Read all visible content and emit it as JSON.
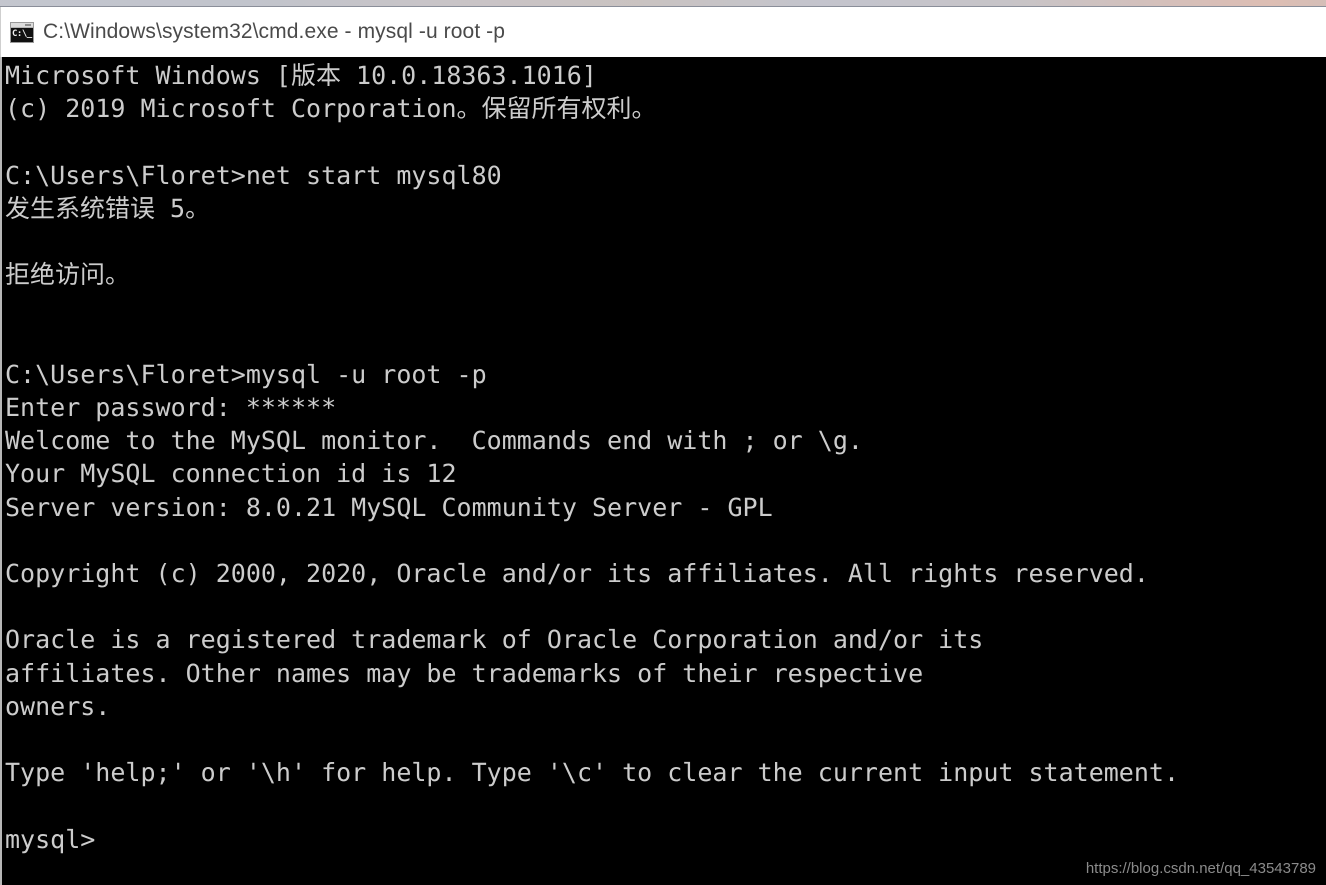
{
  "window": {
    "title": "C:\\Windows\\system32\\cmd.exe - mysql  -u root -p",
    "icon_name": "cmd-console-icon",
    "icon_glyph": "C:\\_",
    "background_color": "#000000",
    "text_color": "#cccccc",
    "titlebar_color": "#ffffff"
  },
  "terminal": {
    "lines": [
      "Microsoft Windows [版本 10.0.18363.1016]",
      "(c) 2019 Microsoft Corporation。保留所有权利。",
      "",
      "C:\\Users\\Floret>net start mysql80",
      "发生系统错误 5。",
      "",
      "拒绝访问。",
      "",
      "",
      "C:\\Users\\Floret>mysql -u root -p",
      "Enter password: ******",
      "Welcome to the MySQL monitor.  Commands end with ; or \\g.",
      "Your MySQL connection id is 12",
      "Server version: 8.0.21 MySQL Community Server - GPL",
      "",
      "Copyright (c) 2000, 2020, Oracle and/or its affiliates. All rights reserved.",
      "",
      "Oracle is a registered trademark of Oracle Corporation and/or its",
      "affiliates. Other names may be trademarks of their respective",
      "owners.",
      "",
      "Type 'help;' or '\\h' for help. Type '\\c' to clear the current input statement.",
      "",
      "mysql>"
    ],
    "full_text": "Microsoft Windows [版本 10.0.18363.1016]\n(c) 2019 Microsoft Corporation。保留所有权利。\n\nC:\\Users\\Floret>net start mysql80\n发生系统错误 5。\n\n拒绝访问。\n\n\nC:\\Users\\Floret>mysql -u root -p\nEnter password: ******\nWelcome to the MySQL monitor.  Commands end with ; or \\g.\nYour MySQL connection id is 12\nServer version: 8.0.21 MySQL Community Server - GPL\n\nCopyright (c) 2000, 2020, Oracle and/or its affiliates. All rights reserved.\n\nOracle is a registered trademark of Oracle Corporation and/or its\naffiliates. Other names may be trademarks of their respective\nowners.\n\nType 'help;' or '\\h' for help. Type '\\c' to clear the current input statement.\n\nmysql>",
    "prompt": "mysql>",
    "os_version": "10.0.18363.1016",
    "mysql_version": "8.0.21",
    "connection_id": "12",
    "username": "Floret",
    "service_name": "mysql80",
    "error_code": "5"
  },
  "watermark": {
    "text": "https://blog.csdn.net/qq_43543789"
  }
}
